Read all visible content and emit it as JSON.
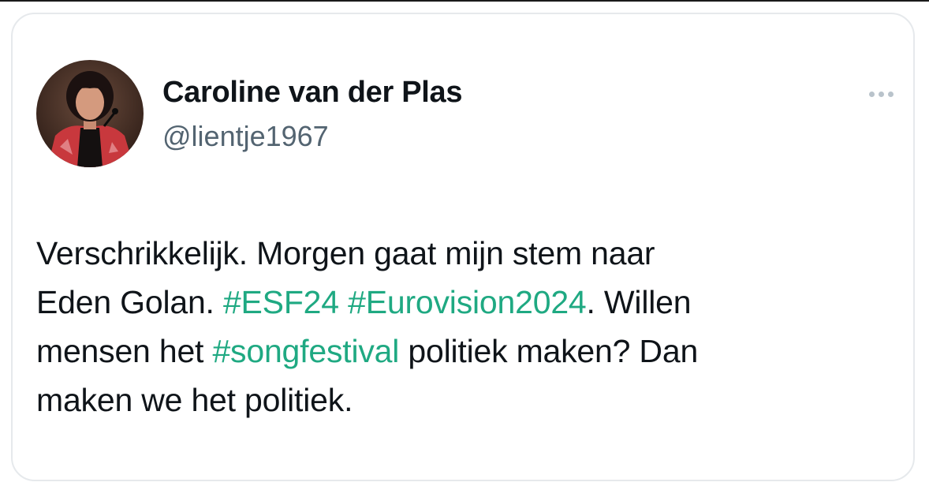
{
  "tweet": {
    "author": {
      "display_name": "Caroline van der Plas",
      "handle": "@lientje1967",
      "avatar_icon": "profile-photo"
    },
    "more_icon": "more-horizontal-icon",
    "text": {
      "line1": "Verschrikkelijk. Morgen gaat mijn stem naar",
      "line2_pre": "Eden Golan. ",
      "hashtag_1": "#ESF24",
      "space_1": " ",
      "hashtag_2": "#Eurovision2024",
      "line2_post": ". Willen",
      "line3_pre": "mensen het ",
      "hashtag_3": "#songfestival",
      "line3_post": " politiek maken? Dan",
      "line4": "maken we het politiek."
    }
  },
  "colors": {
    "hashtag": "#1fa982",
    "text": "#0f1419",
    "secondary_text": "#536471",
    "card_border": "#e6e9ec"
  }
}
